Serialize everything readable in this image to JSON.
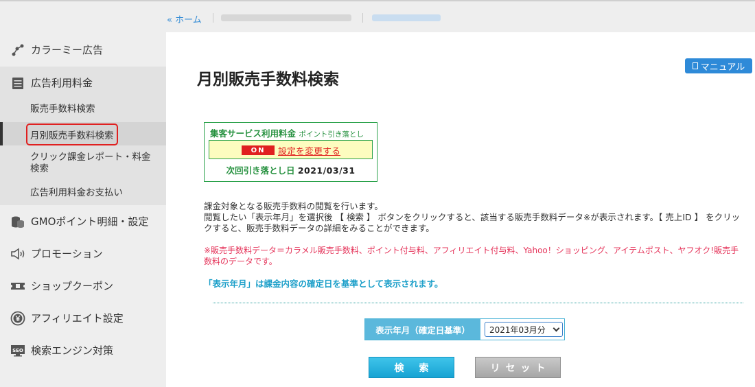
{
  "breadcrumb": {
    "home": "« ホーム"
  },
  "sidebar": {
    "items": [
      {
        "label": "カラーミー広告",
        "icon": "network-icon"
      },
      {
        "label": "広告利用料金",
        "icon": "notepad-icon"
      },
      {
        "label": "GMOポイント明細・設定",
        "icon": "coins-icon"
      },
      {
        "label": "プロモーション",
        "icon": "speaker-icon"
      },
      {
        "label": "ショップクーポン",
        "icon": "ticket-icon"
      },
      {
        "label": "アフィリエイト設定",
        "icon": "yen-coin-icon"
      },
      {
        "label": "検索エンジン対策",
        "icon": "seo-icon"
      }
    ],
    "subitems": [
      {
        "label": "販売手数料検索"
      },
      {
        "label": "月別販売手数料検索"
      },
      {
        "label": "クリック課金レポート・料金検索"
      },
      {
        "label": "広告利用料金お支払い"
      }
    ]
  },
  "main": {
    "title": "月別販売手数料検索",
    "manual_label": "マニュアル",
    "service": {
      "head": "集客サービス利用料金",
      "head_small": "ポイント引き落とし",
      "status": "ON",
      "change_link": "設定を変更する",
      "next_label": "次回引き落とし日",
      "next_date": "2021/03/31"
    },
    "desc_line1": "課金対象となる販売手数料の閲覧を行います。",
    "desc_line2": "閲覧したい「表示年月」を選択後 【 検索 】 ボタンをクリックすると、該当する販売手数料データ※が表示されます。【 売上ID 】 をクリックすると、販売手数料データの詳細をみることができます。",
    "note": "※販売手数料データ＝カラメル販売手数料、ポイント付与料、アフィリエイト付与料、Yahoo！ショッピング、アイテムポスト、ヤフオク!販売手数料のデータです。",
    "note2": "「表示年月」は課金内容の確定日を基準として表示されます。",
    "filter_label": "表示年月（確定日基準）",
    "filter_value": "2021年03月分",
    "search_button": "検索",
    "reset_button": "リセット"
  },
  "colors": {
    "accent": "#2e8ad8",
    "green": "#26913f",
    "red": "#e02020",
    "cyan": "#1c9fc9"
  }
}
